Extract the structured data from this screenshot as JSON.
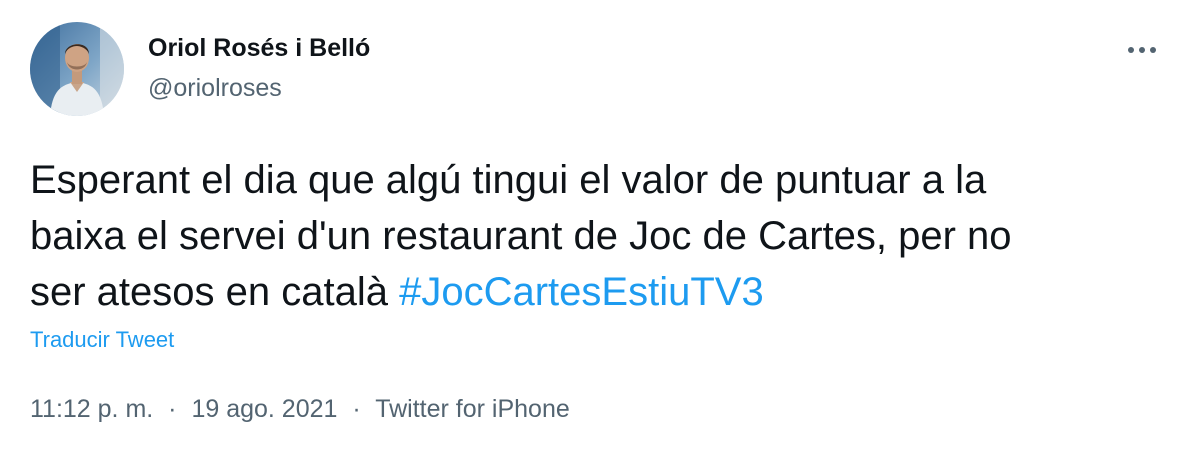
{
  "author": {
    "display_name": "Oriol Rosés i Belló",
    "handle": "@oriolroses",
    "avatar_icon": "profile-photo"
  },
  "tweet": {
    "text_lines": [
      "Esperant el dia que algú tingui el valor de puntuar a la",
      "baixa el servei d'un restaurant de Joc de Cartes, per no",
      "ser atesos en català "
    ],
    "hashtag": "#JocCartesEstiuTV3",
    "translate_label": "Traducir Tweet"
  },
  "meta": {
    "time": "11:12 p. m.",
    "separator": "·",
    "date": "19 ago. 2021",
    "source": "Twitter for iPhone"
  },
  "colors": {
    "text": "#0f1419",
    "secondary": "#536471",
    "link": "#1d9bf0",
    "background": "#ffffff"
  },
  "icons": {
    "more": "more-horizontal-icon"
  }
}
